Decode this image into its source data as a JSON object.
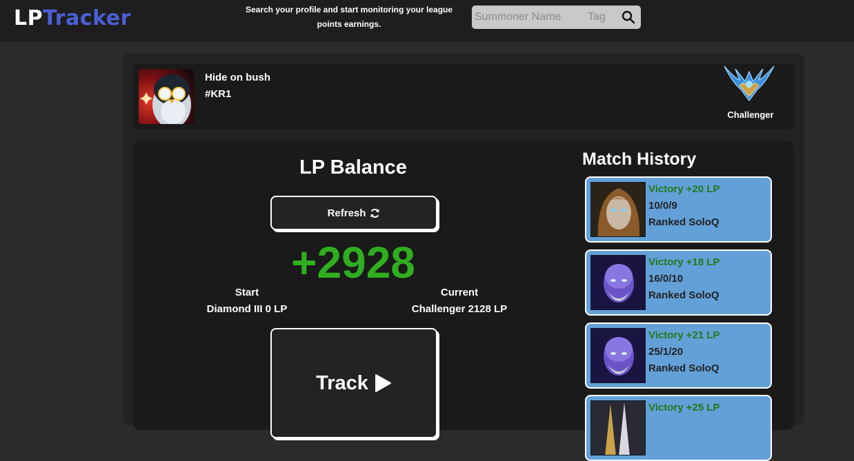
{
  "header": {
    "logo_lp": "LP",
    "logo_tracker": "Tracker",
    "tagline": "Search your profile and start monitoring your league points earnings.",
    "search": {
      "name_placeholder": "Summoner Name",
      "tag_placeholder": "Tag",
      "icon": "search-icon"
    }
  },
  "profile": {
    "name": "Hide on bush",
    "tag": "#KR1",
    "rank": "Challenger",
    "avatar_icon": "penguin-avatar",
    "rank_icon": "challenger-emblem"
  },
  "lp_balance": {
    "title": "LP Balance",
    "refresh_label": "Refresh",
    "refresh_icon": "refresh-icon",
    "value": "+2928",
    "start_label": "Start",
    "start_value": "Diamond III 0 LP",
    "current_label": "Current",
    "current_value": "Challenger 2128 LP",
    "track_label": "Track",
    "track_icon": "play-icon"
  },
  "match_history": {
    "title": "Match History",
    "matches": [
      {
        "result": "Victory +20 LP",
        "kda": "10/0/9",
        "queue": "Ranked SoloQ",
        "champion_icon": "champion-portrait-1"
      },
      {
        "result": "Victory +18 LP",
        "kda": "16/0/10",
        "queue": "Ranked SoloQ",
        "champion_icon": "champion-portrait-2"
      },
      {
        "result": "Victory +21 LP",
        "kda": "25/1/20",
        "queue": "Ranked SoloQ",
        "champion_icon": "champion-portrait-3"
      },
      {
        "result": "Victory +25 LP",
        "kda": "",
        "queue": "",
        "champion_icon": "champion-portrait-4"
      }
    ]
  },
  "colors": {
    "accent_blue": "#4b5fd6",
    "lp_green": "#2fae1f",
    "victory_green": "#1d7a18",
    "match_card_bg": "#63a0d8"
  }
}
